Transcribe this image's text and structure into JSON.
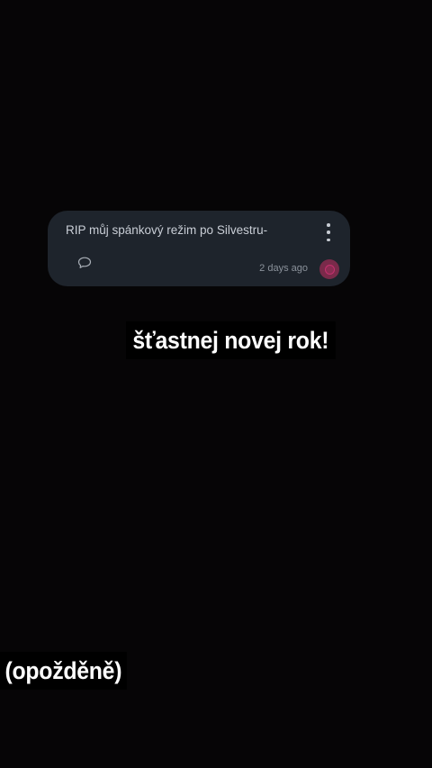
{
  "post": {
    "text": "RIP můj spánkový režim po Silvestru-",
    "timestamp": "2 days ago",
    "icons": {
      "more": "more-vertical-icon",
      "comment": "comment-icon",
      "reaction": "reaction-icon"
    }
  },
  "captions": {
    "line1": "šťastnej novej rok!",
    "line2": "(opožděně)"
  },
  "colors": {
    "background": "#060506",
    "card": "#1e242c",
    "reaction_accent": "#c4306e"
  }
}
